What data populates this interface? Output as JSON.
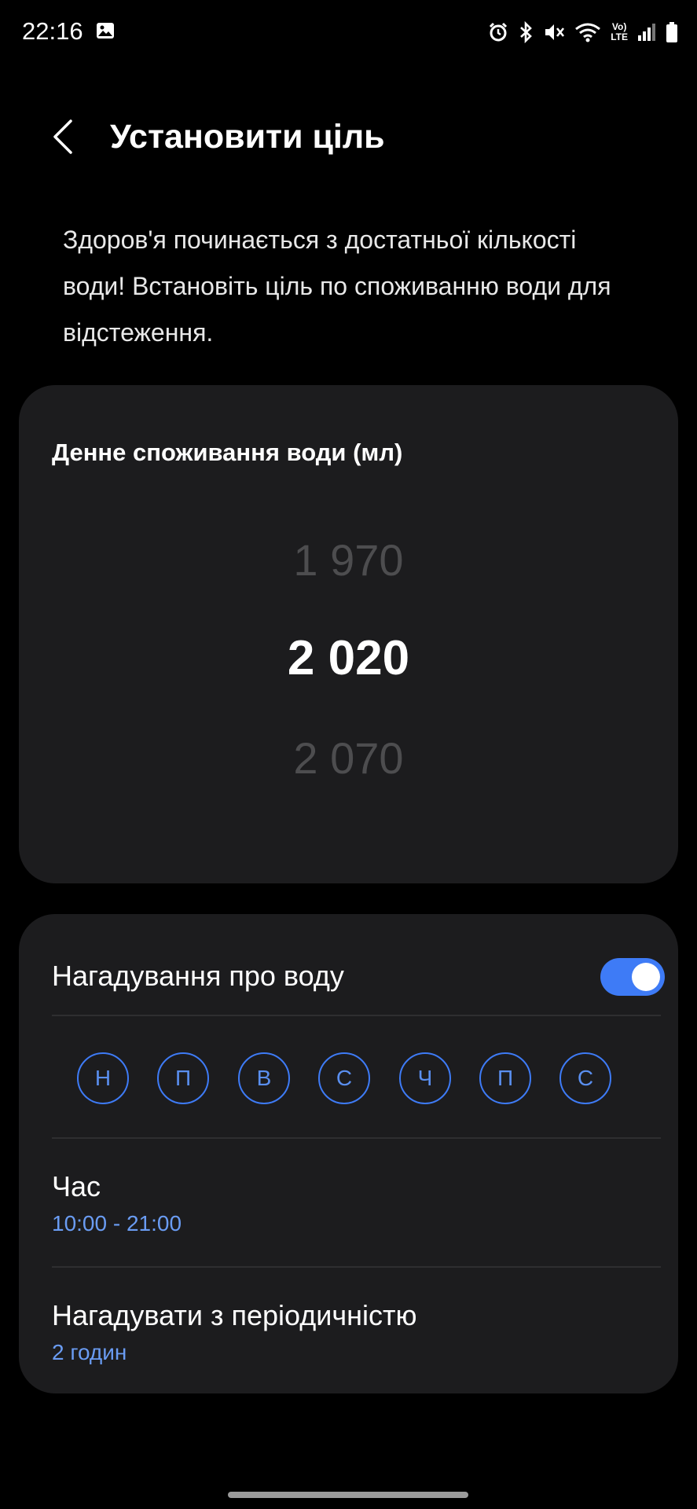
{
  "status_bar": {
    "time": "22:16",
    "icons": [
      "gallery-icon",
      "alarm-icon",
      "bluetooth-icon",
      "mute-icon",
      "wifi-icon",
      "volte-icon",
      "signal-icon",
      "battery-icon"
    ],
    "volte_top": "Vo)",
    "volte_bottom": "LTE"
  },
  "header": {
    "back_icon": "chevron-left-icon",
    "title": "Установити ціль"
  },
  "intro": {
    "text": "Здоров'я починається з достатньої кількості води! Встановіть ціль по споживанню води для відстеження."
  },
  "goal": {
    "label": "Денне споживання води (мл)",
    "picker": {
      "previous": "1 970",
      "selected": "2 020",
      "next": "2 070"
    }
  },
  "reminder": {
    "title": "Нагадування про воду",
    "enabled": true,
    "days": [
      "Н",
      "П",
      "В",
      "С",
      "Ч",
      "П",
      "С"
    ],
    "time_label": "Час",
    "time_value": "10:00 - 21:00",
    "frequency_label": "Нагадувати з періодичністю",
    "frequency_value": "2 годин"
  },
  "colors": {
    "background": "#000000",
    "card": "#1c1c1e",
    "accent": "#3e7bf6",
    "accent_text": "#6a9cf3",
    "picker_dim": "#4d4d4f"
  }
}
